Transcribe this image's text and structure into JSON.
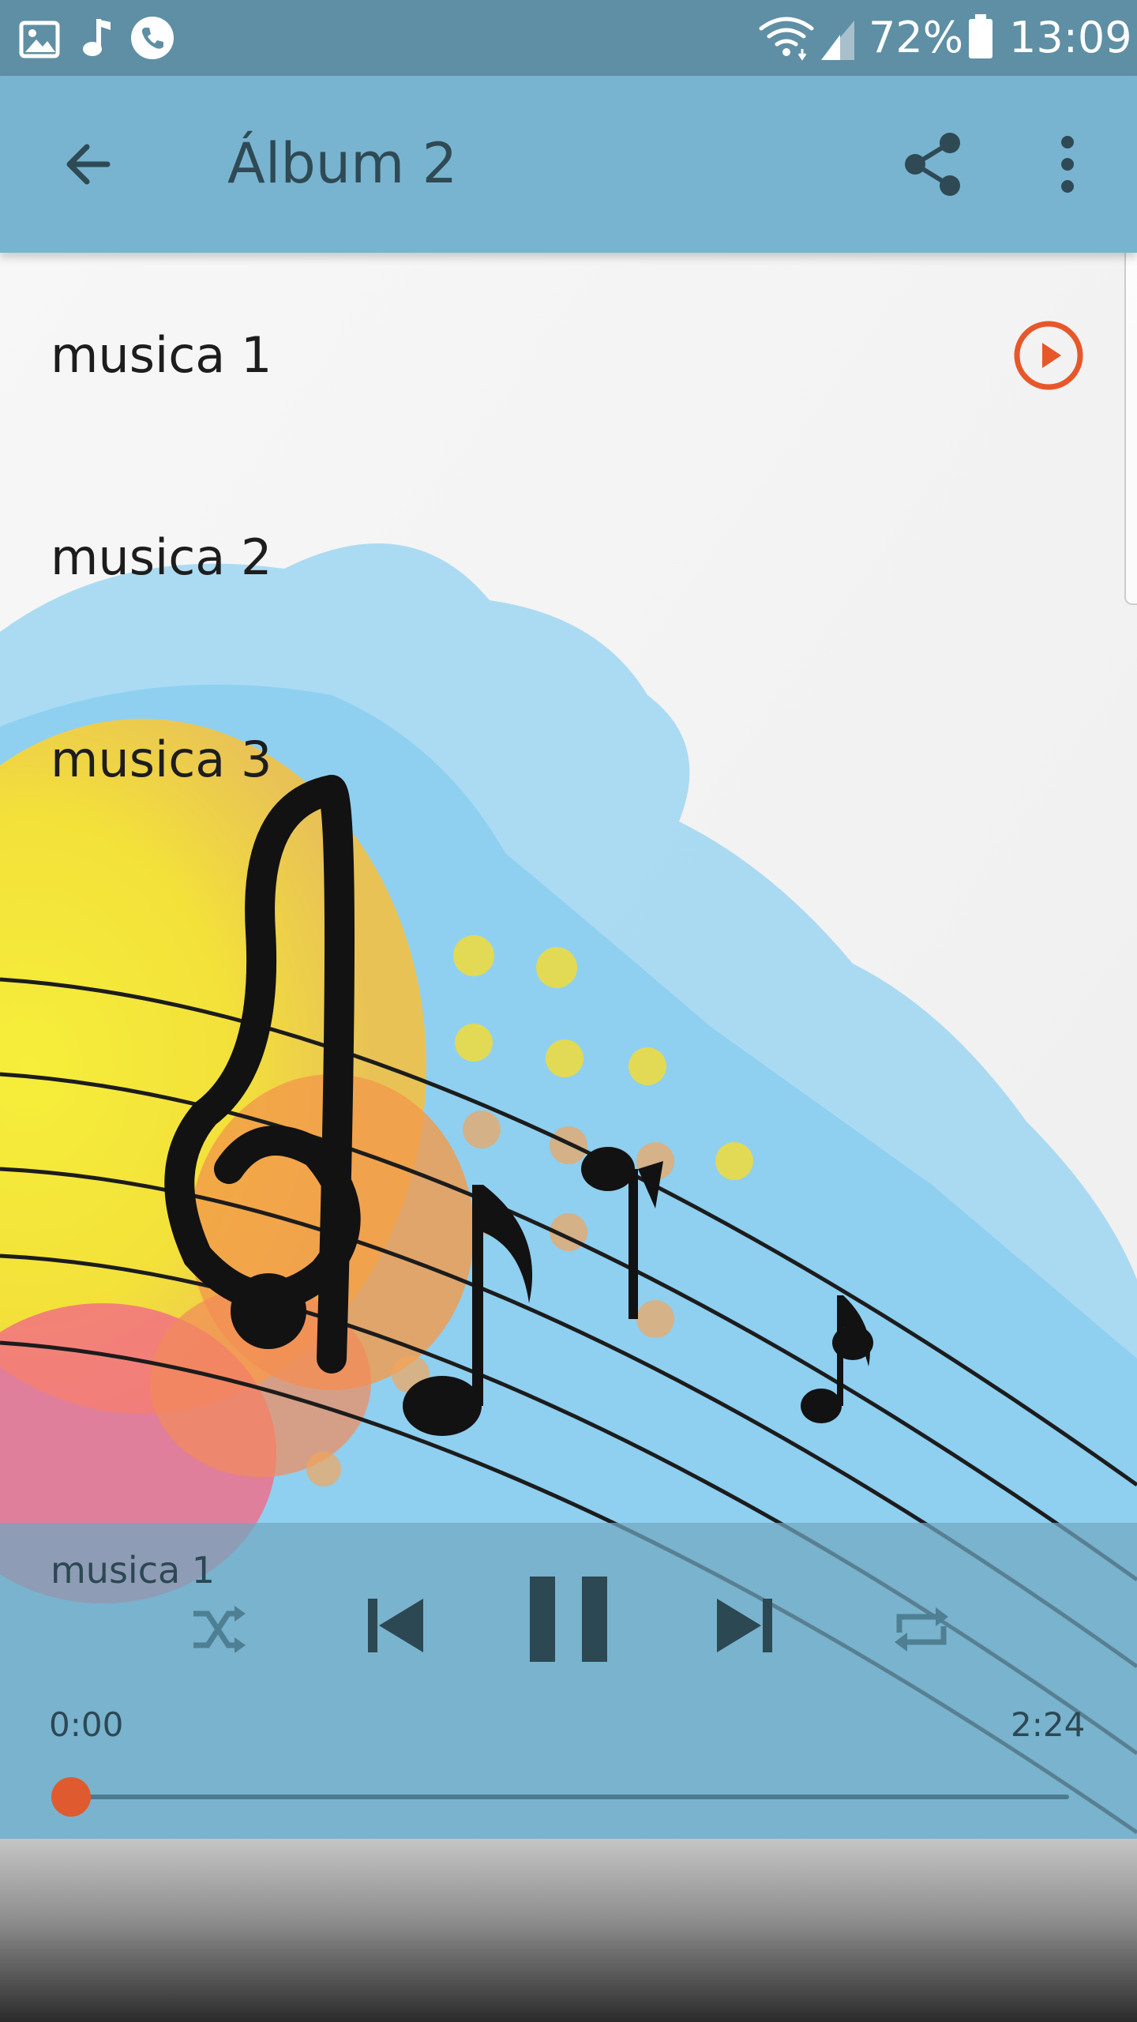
{
  "status_bar": {
    "notification_icons": [
      "image-icon",
      "music-note-icon",
      "phone-icon"
    ],
    "battery_percent": "72%",
    "time": "13:09",
    "icons": [
      "wifi-icon",
      "signal-icon",
      "battery-icon"
    ]
  },
  "app_bar": {
    "title": "Álbum 2",
    "icons": [
      "back-arrow-icon",
      "share-icon",
      "more-vert-icon"
    ]
  },
  "tracks": [
    {
      "name": "musica 1",
      "playing": true
    },
    {
      "name": "musica 2",
      "playing": false
    },
    {
      "name": "musica 3",
      "playing": false
    }
  ],
  "player": {
    "now_playing": "musica 1",
    "current_time": "0:00",
    "total_time": "2:24",
    "progress": 0.0,
    "controls": [
      "shuffle-icon",
      "previous-icon",
      "pause-icon",
      "next-icon",
      "repeat-icon"
    ]
  },
  "colors": {
    "status_bar": "#5f8fa4",
    "app_bar": "#78b4cf",
    "accent": "#e8572a",
    "player_bg": "#70a7c0",
    "text_dark": "#2f4a55"
  }
}
